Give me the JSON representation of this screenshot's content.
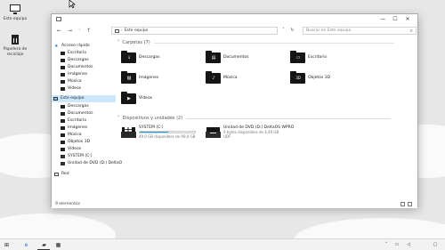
{
  "desktop": {
    "icons": [
      {
        "label": "Este equipo",
        "icon": "computer-icon"
      },
      {
        "label": "Papelera de reciclaje",
        "icon": "recycle-bin-icon"
      }
    ]
  },
  "window": {
    "controls": {
      "minimize": "—",
      "maximize": "☐",
      "close": "✕"
    },
    "address": {
      "chevron": "›",
      "location": "Este equipo"
    },
    "search": {
      "placeholder": "Buscar en Este equipo"
    }
  },
  "nav": {
    "items": [
      {
        "label": "Acceso rápido",
        "icon": "star-icon"
      },
      {
        "label": "Escritorio",
        "icon": "folder-icon"
      },
      {
        "label": "Descargas",
        "icon": "folder-icon"
      },
      {
        "label": "Documentos",
        "icon": "folder-icon"
      },
      {
        "label": "Imágenes",
        "icon": "folder-icon"
      },
      {
        "label": "Música",
        "icon": "folder-icon"
      },
      {
        "label": "Vídeos",
        "icon": "folder-icon"
      },
      {
        "label": "Este equipo",
        "icon": "computer-icon",
        "selected": true
      },
      {
        "label": "Descargas",
        "icon": "folder-icon"
      },
      {
        "label": "Documentos",
        "icon": "folder-icon"
      },
      {
        "label": "Escritorio",
        "icon": "folder-icon"
      },
      {
        "label": "Imágenes",
        "icon": "folder-icon"
      },
      {
        "label": "Música",
        "icon": "folder-icon"
      },
      {
        "label": "Objetos 3D",
        "icon": "folder-icon"
      },
      {
        "label": "Vídeos",
        "icon": "folder-icon"
      },
      {
        "label": "SYSTEM (C:)",
        "icon": "drive-icon"
      },
      {
        "label": "Unidad de DVD (D:) DeltaO",
        "icon": "dvd-icon"
      },
      {
        "label": "Red",
        "icon": "network-icon"
      }
    ]
  },
  "content": {
    "folders_header": "Carpetas (7)",
    "folders": [
      {
        "label": "Descargas",
        "icon": "download-folder-icon",
        "symbol": "↓"
      },
      {
        "label": "Documentos",
        "icon": "documents-folder-icon",
        "symbol": "▤"
      },
      {
        "label": "Escritorio",
        "icon": "desktop-folder-icon",
        "symbol": "▭"
      },
      {
        "label": "Imágenes",
        "icon": "pictures-folder-icon",
        "symbol": "▨"
      },
      {
        "label": "Música",
        "icon": "music-folder-icon",
        "symbol": "♪"
      },
      {
        "label": "Objetos 3D",
        "icon": "3d-objects-folder-icon",
        "symbol": "3D"
      },
      {
        "label": "Vídeos",
        "icon": "videos-folder-icon",
        "symbol": "▶"
      }
    ],
    "drives_header": "Dispositivos y unidades (2)",
    "drives": [
      {
        "label": "SYSTEM (C:)",
        "detail": "49,0 GB disponibles de 99,4 GB",
        "used_fraction": 0.51,
        "icon": "system-drive-icon"
      },
      {
        "label": "Unidad de DVD (D:) DeltaOS WPRO",
        "detail": "0 bytes disponibles de 4,40 GB",
        "filesystem": "UDF",
        "icon": "dvd-drive-icon"
      }
    ]
  },
  "status": {
    "item_count": "9 elementos"
  },
  "taskbar": {
    "items": [
      {
        "icon": "start-icon",
        "glyph": "⊞"
      },
      {
        "icon": "edge-icon",
        "glyph": "e"
      },
      {
        "icon": "file-explorer-icon",
        "glyph": "▰"
      },
      {
        "icon": "store-icon",
        "glyph": "▦"
      }
    ],
    "tray": [
      {
        "icon": "chevron-up-icon",
        "glyph": "˄"
      },
      {
        "icon": "network-icon",
        "glyph": "▭"
      },
      {
        "icon": "volume-icon",
        "glyph": "◁"
      },
      {
        "icon": "notifications-icon",
        "glyph": "▢"
      }
    ]
  }
}
